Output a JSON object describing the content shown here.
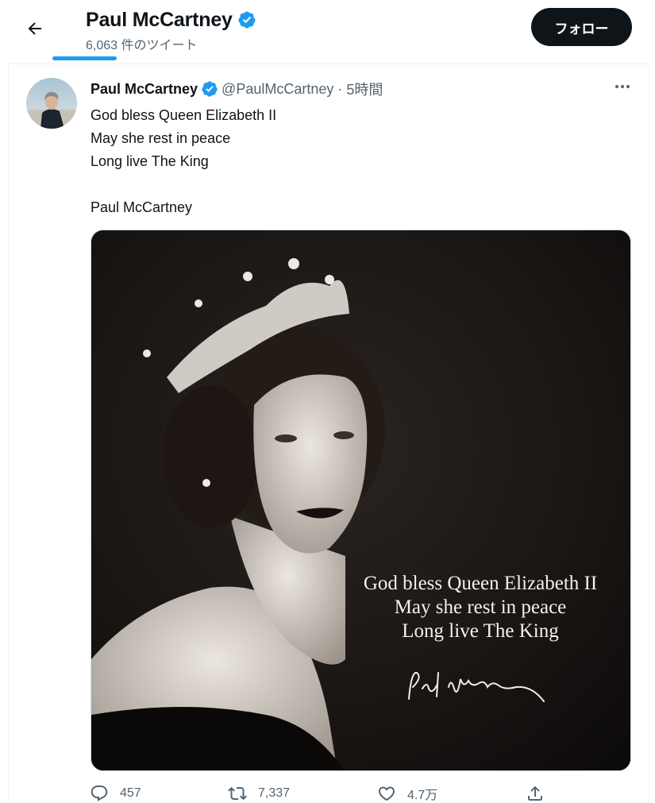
{
  "header": {
    "title": "Paul McCartney",
    "tweet_count": "6,063 件のツイート",
    "follow_label": "フォロー"
  },
  "tweet": {
    "author_name": "Paul McCartney",
    "handle": "@PaulMcCartney",
    "separator": "·",
    "time": "5時間",
    "lines": [
      "God bless Queen Elizabeth II",
      "May she rest in peace",
      "Long live The King",
      "",
      "Paul McCartney"
    ],
    "image": {
      "overlay_lines": [
        "God bless Queen Elizabeth II",
        "May she rest in peace",
        "Long live The King"
      ],
      "signature": "Paul McCartney"
    },
    "actions": {
      "replies": "457",
      "retweets": "7,337",
      "likes": "4.7万"
    }
  },
  "colors": {
    "accent": "#1d9bf0",
    "text": "#0f1419",
    "secondary_text": "#536471",
    "follow_button": "#0f1419"
  },
  "icons": [
    "back-arrow-icon",
    "verified-badge-icon",
    "more-icon",
    "reply-icon",
    "retweet-icon",
    "like-icon",
    "share-icon"
  ]
}
